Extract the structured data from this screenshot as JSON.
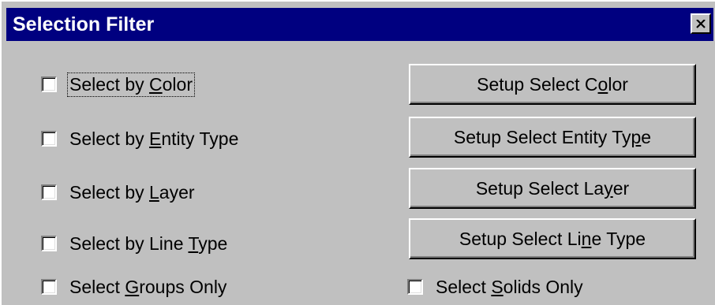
{
  "window": {
    "title": "Selection Filter",
    "close_icon": "close-icon"
  },
  "checkboxes": [
    {
      "pre": "Select by ",
      "mnemonic": "C",
      "post": "olor",
      "checked": false,
      "focused": true
    },
    {
      "pre": "Select by ",
      "mnemonic": "E",
      "post": "ntity Type",
      "checked": false
    },
    {
      "pre": "Select by ",
      "mnemonic": "L",
      "post": "ayer",
      "checked": false
    },
    {
      "pre": "Select by Line ",
      "mnemonic": "T",
      "post": "ype",
      "checked": false
    },
    {
      "pre": "Select ",
      "mnemonic": "G",
      "post": "roups Only",
      "checked": false
    },
    {
      "pre": "Select ",
      "mnemonic": "S",
      "post": "olids Only",
      "checked": false
    }
  ],
  "buttons": [
    {
      "pre": "Setup Select C",
      "mnemonic": "o",
      "post": "lor"
    },
    {
      "pre": "Setup Select Entity Ty",
      "mnemonic": "p",
      "post": "e"
    },
    {
      "pre": "Setup Select La",
      "mnemonic": "y",
      "post": "er"
    },
    {
      "pre": "Setup Select Li",
      "mnemonic": "n",
      "post": "e Type"
    }
  ],
  "colors": {
    "titlebar": "#000080",
    "face": "#c0c0c0"
  }
}
